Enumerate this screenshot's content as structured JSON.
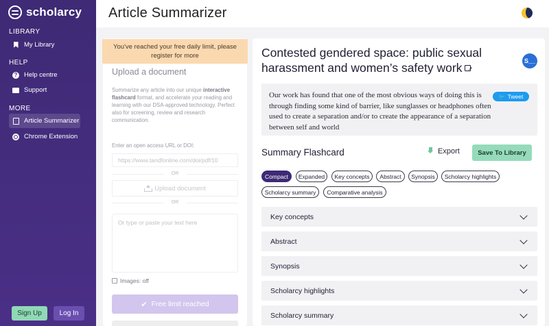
{
  "sidebar": {
    "brand": "scholarcy",
    "sections": {
      "library": "LIBRARY",
      "help": "HELP",
      "more": "MORE"
    },
    "items": {
      "my_library": "My Library",
      "help_centre": "Help centre",
      "support": "Support",
      "article_summarizer": "Article Summarizer",
      "chrome_extension": "Chrome Extension"
    },
    "signup": "Sign Up",
    "login": "Log In"
  },
  "header": {
    "title": "Article Summarizer"
  },
  "upload": {
    "limit_banner": "You've reached your free daily limit, please register for more",
    "title": "Upload a document",
    "desc_pre": "Summarize any article into our unique ",
    "desc_bold": "interactive flashcard",
    "desc_post": " format, and accelerate your reading and learning with our DSA-approved technology. Perfect also for screening, review and research communication.",
    "url_label": "Enter an open access URL or DOI:",
    "url_placeholder": "https://www.tandfonline.com/doi/pdf/10",
    "or1": "OR",
    "upload_button": "Upload document",
    "or2": "OR",
    "text_placeholder": "Or type or paste your text here",
    "images_label": "Images: off",
    "limit_button": "Free limit reached"
  },
  "article": {
    "title": "Contested gendered space: public sexual harassment and women’s safety work",
    "avatar": "S__",
    "quote": "Our work has found that one of the most obvious ways of doing this is through finding some kind of barrier, like sunglasses or headphones often used to create a separation and/or to create the appearance of a separation between self and world",
    "tweet": "Tweet"
  },
  "flashcard": {
    "title": "Summary Flashcard",
    "export": "Export",
    "save": "Save To Library",
    "tabs": [
      "Compact",
      "Expanded",
      "Key concepts",
      "Abstract",
      "Synopsis",
      "Scholarcy highlights",
      "Scholarcy summary",
      "Comparative analysis"
    ],
    "active_tab": "Compact",
    "sections": [
      "Key concepts",
      "Abstract",
      "Synopsis",
      "Scholarcy highlights",
      "Scholarcy summary"
    ]
  },
  "colors": {
    "sidebar": "#3e2a75",
    "accent_green": "#95dbb9",
    "banner": "#fbd9b0",
    "tweet": "#1d9bf0"
  }
}
